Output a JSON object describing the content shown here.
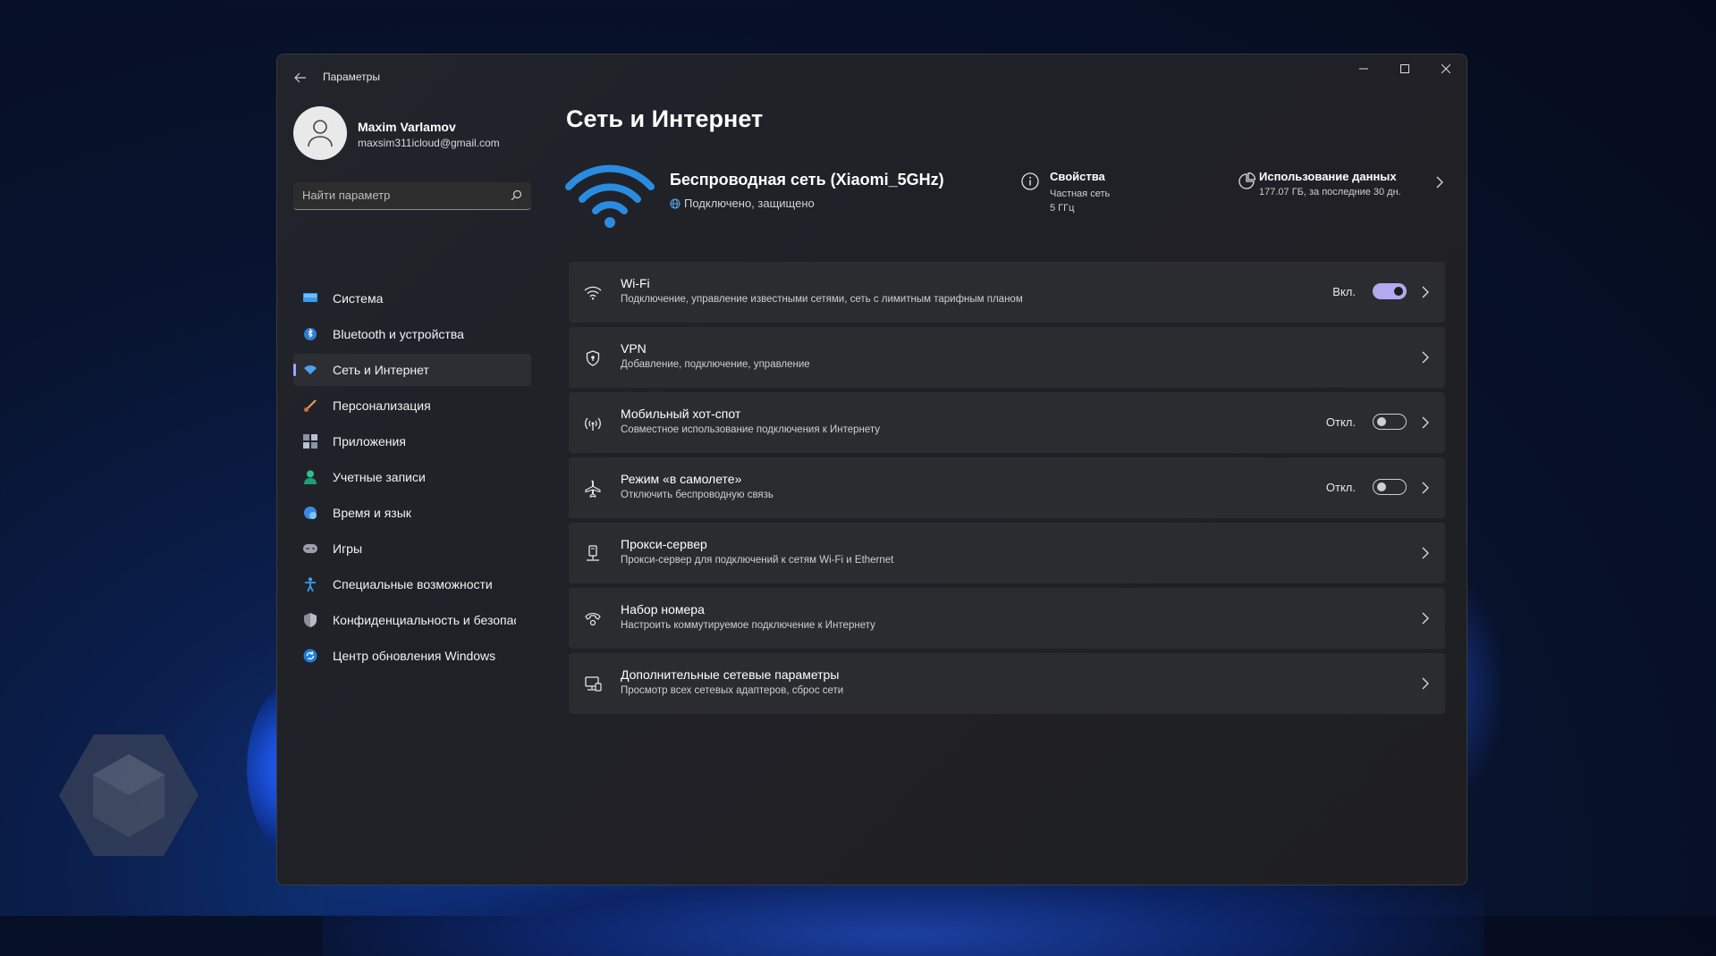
{
  "window": {
    "app_title": "Параметры",
    "accent": "#0078d4"
  },
  "user": {
    "name": "Maxim Varlamov",
    "email": "maxsim311icloud@gmail.com"
  },
  "search": {
    "placeholder": "Найти параметр"
  },
  "nav": {
    "items": [
      {
        "label": "Система",
        "icon": "system-icon",
        "active": false
      },
      {
        "label": "Bluetooth и устройства",
        "icon": "bluetooth-icon",
        "active": false
      },
      {
        "label": "Сеть и Интернет",
        "icon": "network-icon",
        "active": true
      },
      {
        "label": "Персонализация",
        "icon": "brush-icon",
        "active": false
      },
      {
        "label": "Приложения",
        "icon": "apps-icon",
        "active": false
      },
      {
        "label": "Учетные записи",
        "icon": "account-icon",
        "active": false
      },
      {
        "label": "Время и язык",
        "icon": "globe-clock-icon",
        "active": false
      },
      {
        "label": "Игры",
        "icon": "gamepad-icon",
        "active": false
      },
      {
        "label": "Специальные возможности",
        "icon": "accessibility-icon",
        "active": false
      },
      {
        "label": "Конфиденциальность и безопасность",
        "icon": "shield-icon",
        "active": false
      },
      {
        "label": "Центр обновления Windows",
        "icon": "update-icon",
        "active": false
      }
    ]
  },
  "main": {
    "title": "Сеть и Интернет",
    "connection": {
      "name": "Беспроводная сеть (Xiaomi_5GHz)",
      "status": "Подключено, защищено"
    },
    "properties": {
      "title": "Свойства",
      "line1": "Частная сеть",
      "line2": "5 ГГц"
    },
    "usage": {
      "title": "Использование данных",
      "detail": "177.07 ГБ, за последние 30 дн."
    },
    "cards": [
      {
        "title": "Wi-Fi",
        "subtitle": "Подключение, управление известными сетями, сеть с лимитным тарифным планом",
        "icon": "wifi-icon",
        "state": "Вкл.",
        "toggle": "on"
      },
      {
        "title": "VPN",
        "subtitle": "Добавление, подключение, управление",
        "icon": "vpn-shield-icon",
        "state": "",
        "toggle": "none"
      },
      {
        "title": "Мобильный хот-спот",
        "subtitle": "Совместное использование подключения к Интернету",
        "icon": "hotspot-icon",
        "state": "Откл.",
        "toggle": "off"
      },
      {
        "title": "Режим «в самолете»",
        "subtitle": "Отключить беспроводную связь",
        "icon": "airplane-icon",
        "state": "Откл.",
        "toggle": "off"
      },
      {
        "title": "Прокси-сервер",
        "subtitle": "Прокси-сервер для подключений к сетям Wi-Fi и Ethernet",
        "icon": "proxy-icon",
        "state": "",
        "toggle": "none"
      },
      {
        "title": "Набор номера",
        "subtitle": "Настроить коммутируемое подключение к Интернету",
        "icon": "dialup-icon",
        "state": "",
        "toggle": "none"
      },
      {
        "title": "Дополнительные сетевые параметры",
        "subtitle": "Просмотр всех сетевых адаптеров, сброс сети",
        "icon": "network-adapter-icon",
        "state": "",
        "toggle": "none"
      }
    ]
  }
}
